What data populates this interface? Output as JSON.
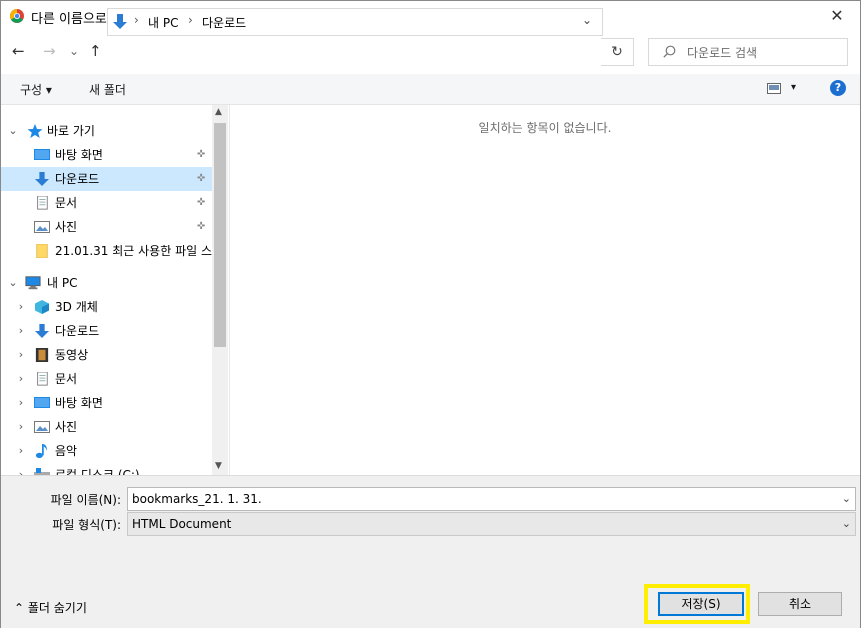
{
  "window": {
    "title": "다른 이름으로 저장",
    "close_glyph": "✕"
  },
  "nav": {
    "back": "←",
    "forward": "→",
    "recent": "⌄",
    "up": "↑",
    "breadcrumb": [
      "내 PC",
      "다운로드"
    ],
    "sep": "›",
    "refresh": "↻",
    "search_placeholder": "다운로드 검색"
  },
  "toolbar": {
    "organize": "구성 ▾",
    "new_folder": "새 폴더",
    "view_arrow": "▾",
    "help": "?"
  },
  "tree": {
    "quick_access": {
      "label": "바로 가기",
      "items": [
        {
          "label": "바탕 화면",
          "pinned": true
        },
        {
          "label": "다운로드",
          "pinned": true,
          "selected": true
        },
        {
          "label": "문서",
          "pinned": true
        },
        {
          "label": "사진",
          "pinned": true
        },
        {
          "label": "21.01.31 최근 사용한 파일 스"
        }
      ]
    },
    "this_pc": {
      "label": "내 PC",
      "items": [
        {
          "label": "3D 개체"
        },
        {
          "label": "다운로드"
        },
        {
          "label": "동영상"
        },
        {
          "label": "문서"
        },
        {
          "label": "바탕 화면"
        },
        {
          "label": "사진"
        },
        {
          "label": "음악"
        },
        {
          "label": "로컬 디스크 (C:)"
        }
      ]
    },
    "pin_glyph": "📌"
  },
  "content": {
    "empty_message": "일치하는 항목이 없습니다."
  },
  "form": {
    "filename_label": "파일 이름(N):",
    "filename_value": "bookmarks_21. 1. 31.",
    "filetype_label": "파일 형식(T):",
    "filetype_value": "HTML Document",
    "dropdown_glyph": "⌄"
  },
  "footer": {
    "hide_folders": "⌃  폴더 숨기기",
    "save": "저장(S)",
    "cancel": "취소"
  },
  "colors": {
    "accent": "#0078d7",
    "selection": "#cce8ff",
    "highlight": "#ffee00"
  }
}
